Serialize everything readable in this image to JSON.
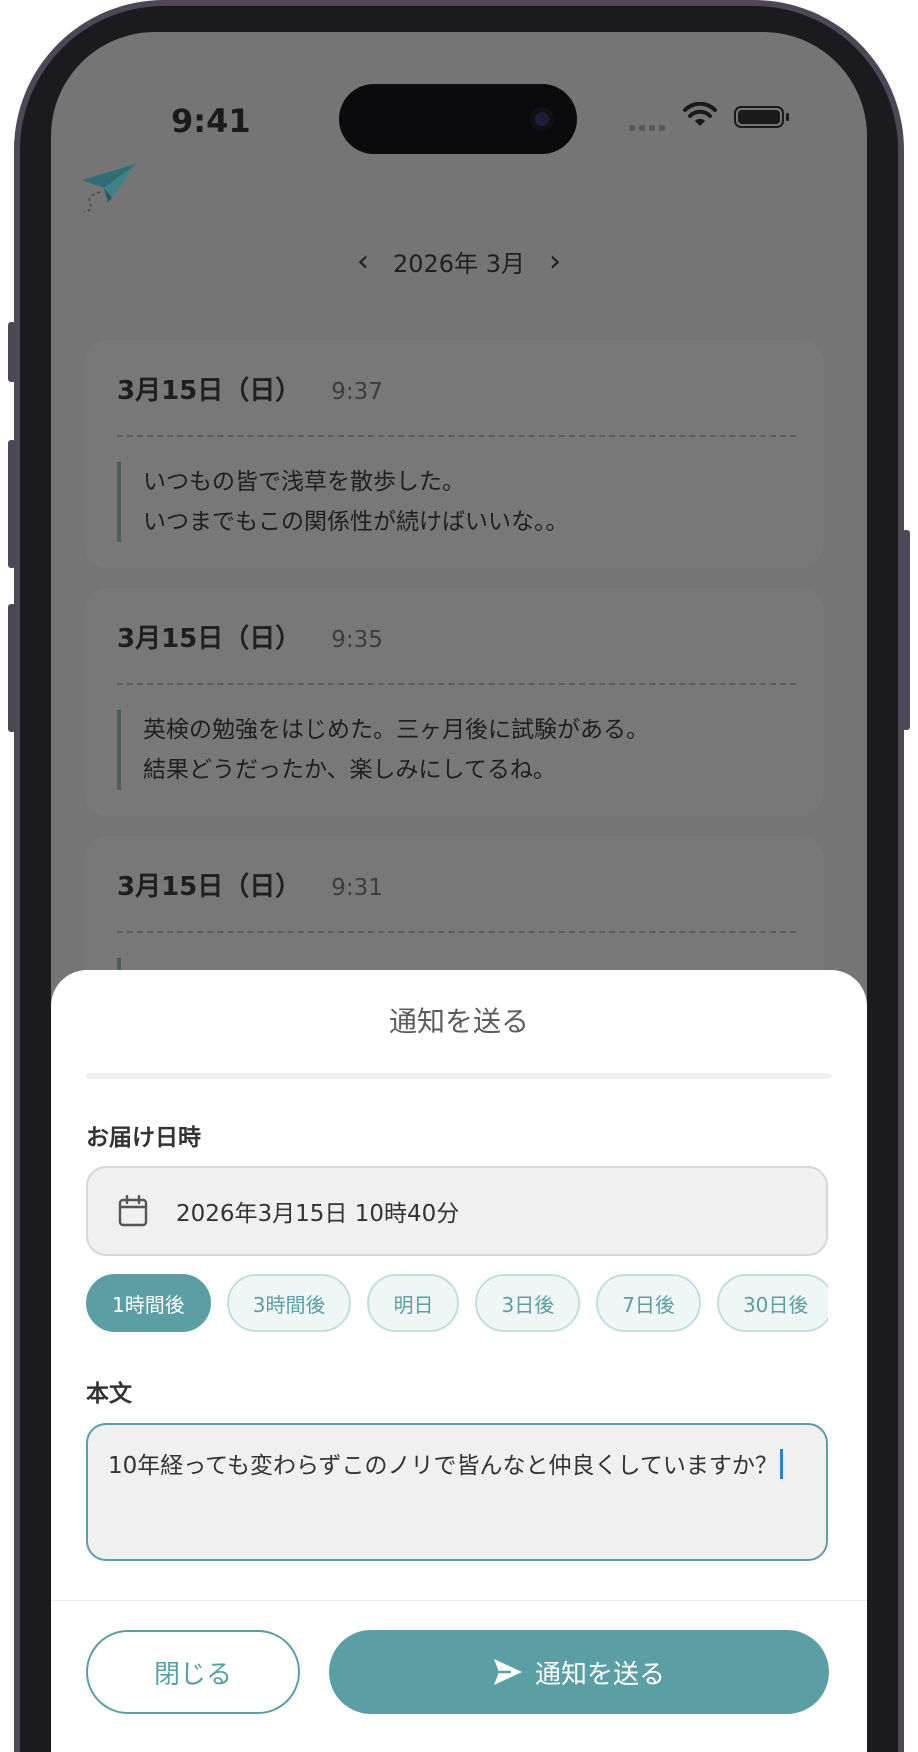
{
  "status_bar": {
    "time": "9:41"
  },
  "header": {
    "month_label": "2026年 3月"
  },
  "entries": [
    {
      "date": "3月15日（日）",
      "time": "9:37",
      "lines": [
        "いつもの皆で浅草を散歩した。",
        "いつまでもこの関係性が続けばいいな。。"
      ]
    },
    {
      "date": "3月15日（日）",
      "time": "9:35",
      "lines": [
        "英検の勉強をはじめた。三ヶ月後に試験がある。",
        "結果どうだったか、楽しみにしてるね。"
      ]
    },
    {
      "date": "3月15日（日）",
      "time": "9:31",
      "lines": []
    }
  ],
  "sheet": {
    "title": "通知を送る",
    "delivery_label": "お届け日時",
    "delivery_value": "2026年3月15日 10時40分",
    "quick_options": [
      "1時間後",
      "3時間後",
      "明日",
      "3日後",
      "7日後",
      "30日後"
    ],
    "selected_option": "1時間後",
    "body_label": "本文",
    "body_text": "10年経っても変わらずこのノリで皆んなと仲良くしていますか？",
    "close_label": "閉じる",
    "send_label": "通知を送る"
  },
  "colors": {
    "accent": "#5b9fa4",
    "overlay": "#757575",
    "sheet": "#ffffff"
  },
  "icons": [
    "paper-plane-logo-icon",
    "chevron-left-icon",
    "chevron-right-icon",
    "calendar-icon",
    "send-icon",
    "wifi-icon",
    "battery-icon"
  ]
}
